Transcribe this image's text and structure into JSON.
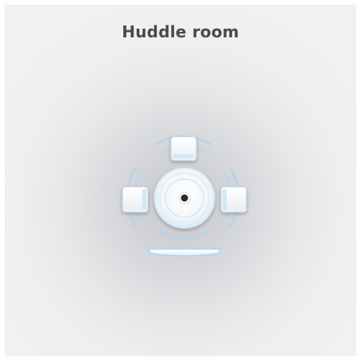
{
  "room": {
    "title": "Huddle room"
  },
  "colors": {
    "accent": "#9fd0ee",
    "seat": "#f7f8fa",
    "device": "#2b2b2b"
  },
  "icons": {
    "camera": "camera-device-icon",
    "display": "display-bar-icon"
  }
}
